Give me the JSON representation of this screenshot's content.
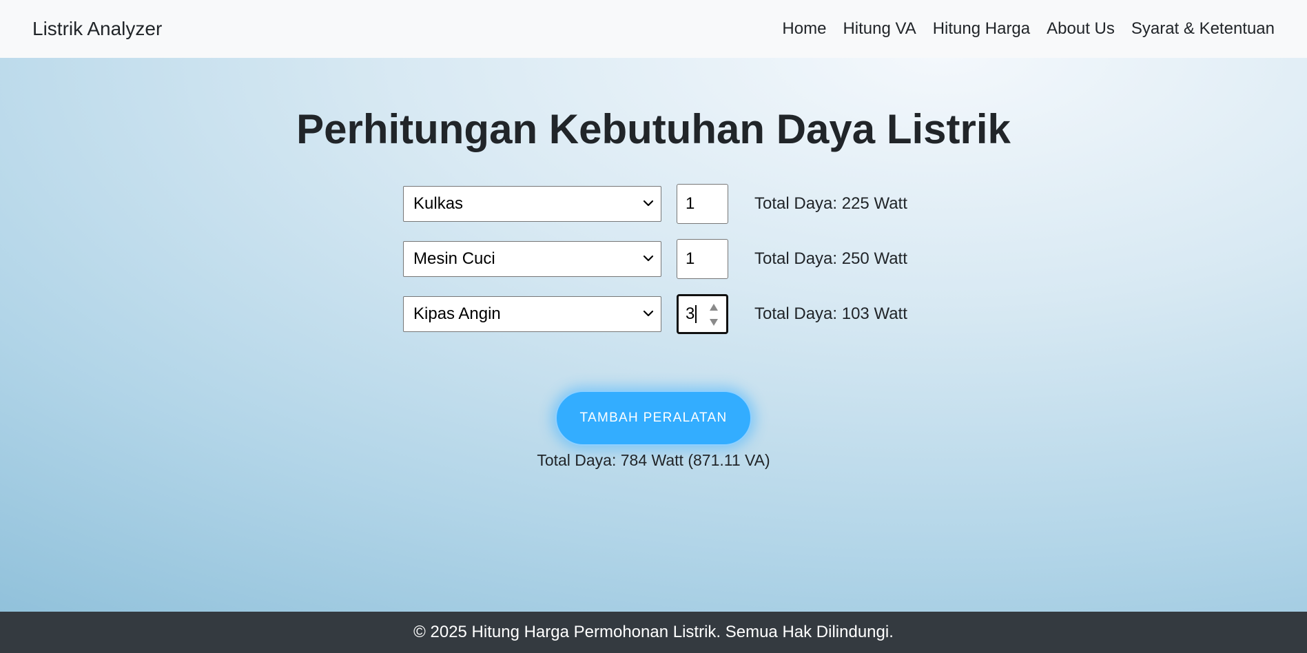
{
  "navbar": {
    "brand": "Listrik Analyzer",
    "links": [
      "Home",
      "Hitung VA",
      "Hitung Harga",
      "About Us",
      "Syarat & Ketentuan"
    ]
  },
  "page": {
    "title": "Perhitungan Kebutuhan Daya Listrik"
  },
  "appliances": [
    {
      "device": "Kulkas",
      "quantity": "1",
      "total": "Total Daya: 225 Watt"
    },
    {
      "device": "Mesin Cuci",
      "quantity": "1",
      "total": "Total Daya: 250 Watt"
    },
    {
      "device": "Kipas Angin",
      "quantity": "3",
      "total": "Total Daya: 103 Watt"
    }
  ],
  "actions": {
    "add_button": "TAMBAH PERALATAN"
  },
  "summary": {
    "total": "Total Daya: 784 Watt (871.11 VA)"
  },
  "footer": {
    "text": "© 2025 Hitung Harga Permohonan Listrik. Semua Hak Dilindungi."
  },
  "colors": {
    "navbar_bg": "#f8f9fa",
    "button_bg": "#33adff",
    "footer_bg": "#343a40"
  },
  "icons": {
    "select_arrow": "chevron-down-icon",
    "spinner": "spinner-arrows-icon"
  }
}
